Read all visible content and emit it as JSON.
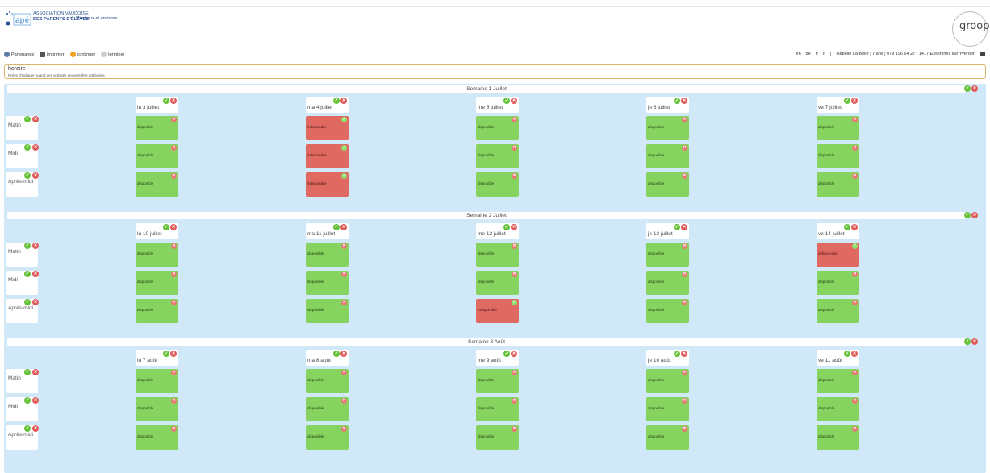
{
  "header": {
    "logo_small": "ASSOCIATION VAUDOISE",
    "logo_big": "DES PARENTS D'ÉLÈVES",
    "logo_region": "Montreux et environs",
    "logo_mark": "apé",
    "brand": "groople"
  },
  "toolbar": {
    "partenaires": "Partenaires",
    "imprimer": "imprimer",
    "continuer": "continuer",
    "terminer": "terminer"
  },
  "topright": {
    "langs": [
      "en",
      "de",
      "fr",
      "it"
    ],
    "separator": "|",
    "user": "Isabelle La Belle | 7 ans | 079 196 64 27 | 1417 Essertines sur Yverdon"
  },
  "horaire": {
    "title": "horaire",
    "subtitle": "Prière d'indiquer quand des activités peuvent être attribuées."
  },
  "slot_labels": [
    "Matin",
    "Midi",
    "Après-midi"
  ],
  "status": {
    "ok": "disponible",
    "ko": "indisponible"
  },
  "weeks": [
    {
      "title": "Semaine 1 Juillet",
      "days": [
        "lu 3 juillet",
        "ma 4 juillet",
        "me 5 juillet",
        "je 6 juillet",
        "ve 7 juillet"
      ],
      "grid": [
        [
          "disponible",
          "indisponible",
          "disponible",
          "disponible",
          "disponible"
        ],
        [
          "disponible",
          "indisponible",
          "disponible",
          "disponible",
          "disponible"
        ],
        [
          "disponible",
          "indisponible",
          "disponible",
          "disponible",
          "disponible"
        ]
      ]
    },
    {
      "title": "Semaine 2 Juillet",
      "days": [
        "lu 10 juillet",
        "ma 11 juillet",
        "me 12 juillet",
        "je 13 juillet",
        "ve 14 juillet"
      ],
      "grid": [
        [
          "disponible",
          "disponible",
          "disponible",
          "disponible",
          "indisponible"
        ],
        [
          "disponible",
          "disponible",
          "disponible",
          "disponible",
          "disponible"
        ],
        [
          "disponible",
          "disponible",
          "indisponible",
          "disponible",
          "disponible"
        ]
      ]
    },
    {
      "title": "Semaine 3 Août",
      "days": [
        "lu 7 août",
        "ma 8 août",
        "me 9 août",
        "je 10 août",
        "ve 11 août"
      ],
      "grid": [
        [
          "disponible",
          "disponible",
          "disponible",
          "disponible",
          "disponible"
        ],
        [
          "disponible",
          "disponible",
          "disponible",
          "disponible",
          "disponible"
        ],
        [
          "disponible",
          "disponible",
          "disponible",
          "disponible",
          "disponible"
        ]
      ]
    }
  ],
  "colors": {
    "available": "#86d45f",
    "unavailable": "#e06a62",
    "background": "#d0e8f7",
    "ok_badge": "#67c23a",
    "remove_badge": "#e05a5a"
  }
}
